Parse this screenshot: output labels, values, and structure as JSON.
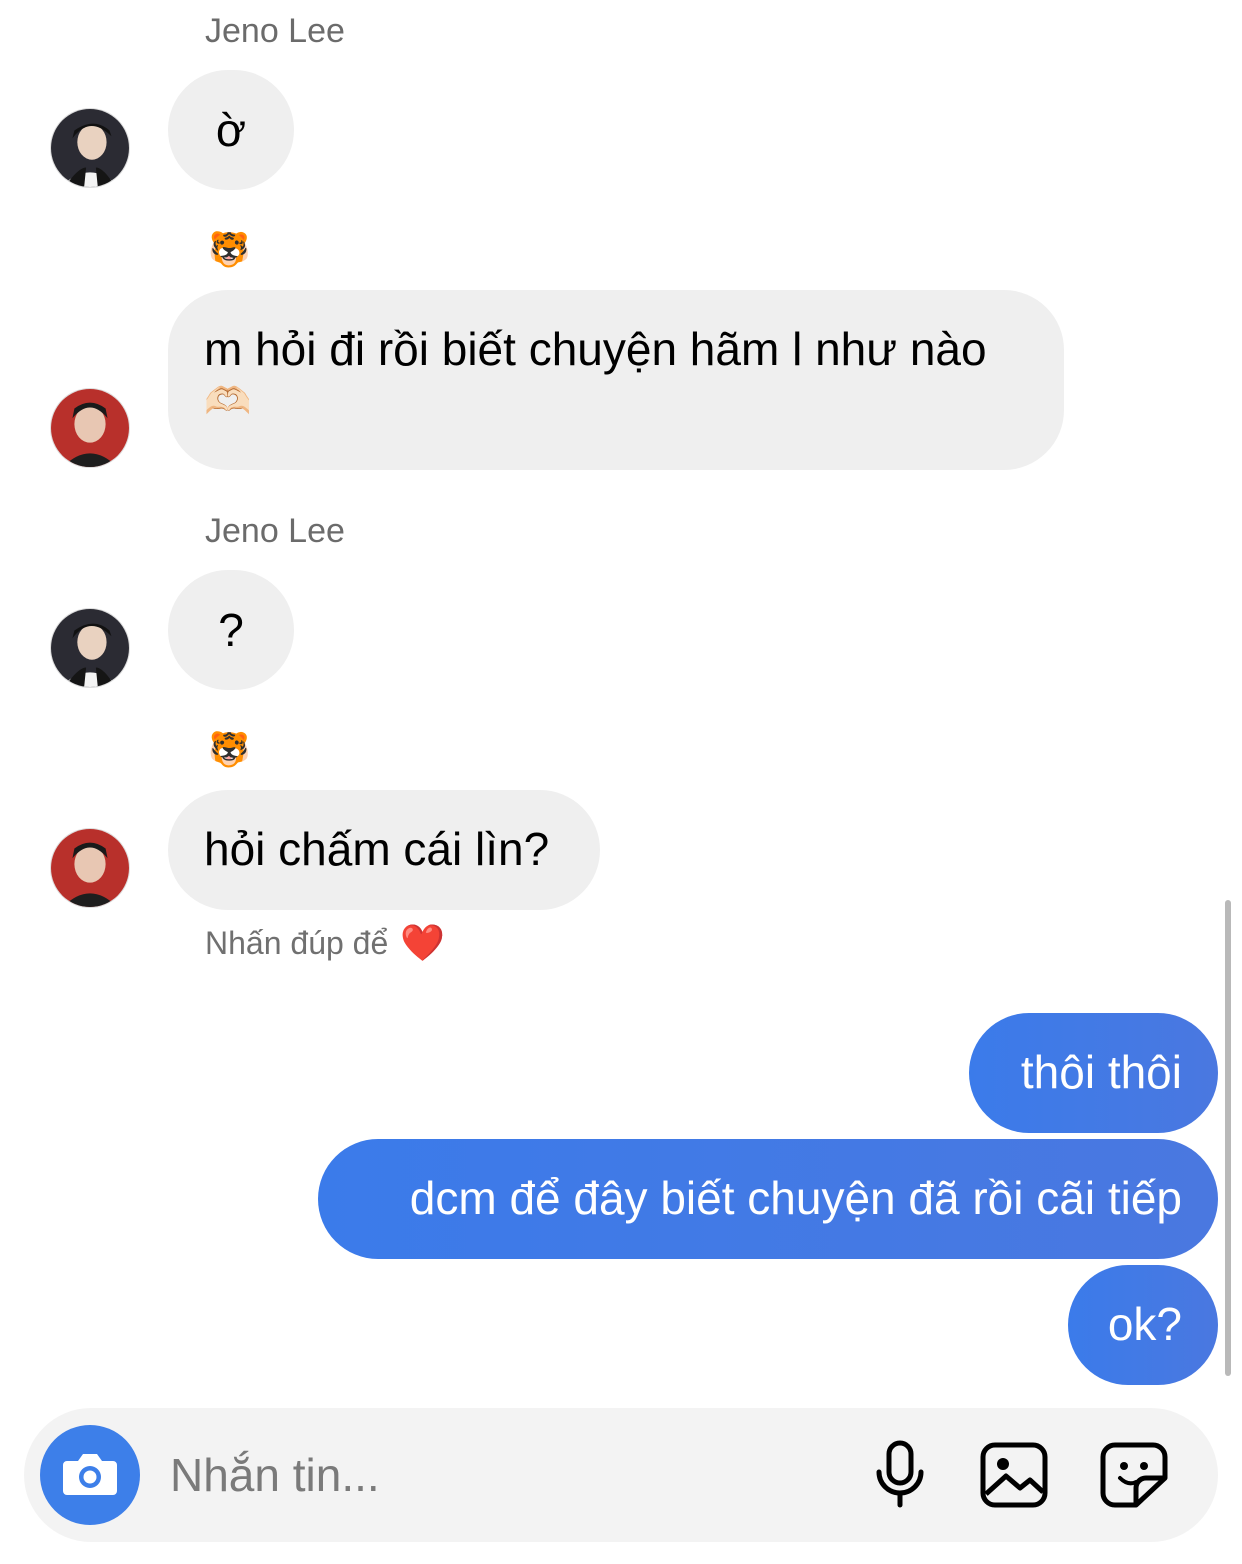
{
  "messages": [
    {
      "sender_name": "Jeno Lee",
      "text": "ờ"
    },
    {
      "reaction_emoji": "🐯",
      "text": "m hỏi đi rồi biết chuyện hãm l như nào",
      "text_emoji": "🫶🏻"
    },
    {
      "sender_name": "Jeno Lee",
      "text": "?"
    },
    {
      "reaction_emoji": "🐯",
      "text": "hỏi chấm cái lìn?",
      "hint": "Nhấn đúp để",
      "hint_emoji": "❤️"
    },
    {
      "outgoing": true,
      "text": "thôi thôi"
    },
    {
      "outgoing": true,
      "text": "dcm để đây biết chuyện đã rồi cãi tiếp"
    },
    {
      "outgoing": true,
      "text": "ok?"
    }
  ],
  "composer": {
    "placeholder": "Nhắn tin...",
    "icons": [
      "camera-icon",
      "microphone-icon",
      "gallery-icon",
      "sticker-icon"
    ]
  },
  "colors": {
    "outgoing_bubble": "#3b7bea",
    "incoming_bubble": "#efefef",
    "camera_button": "#3d7fe9"
  }
}
